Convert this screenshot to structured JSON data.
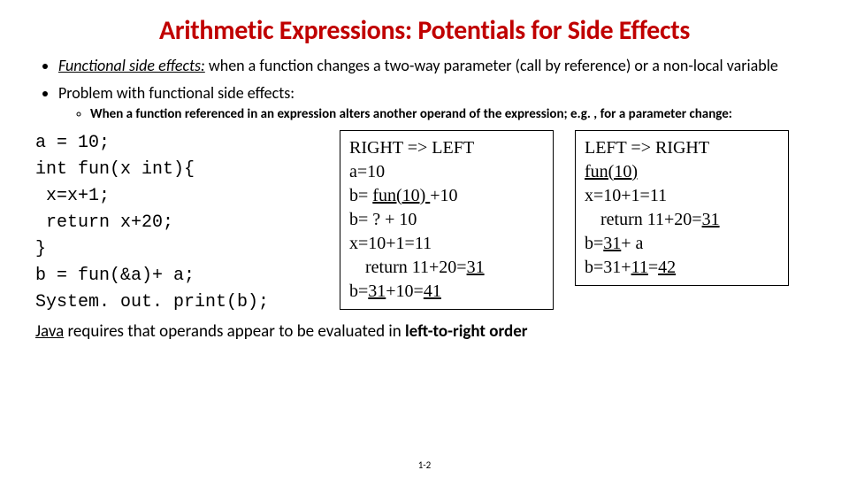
{
  "title": "Arithmetic Expressions: Potentials for Side Effects",
  "bullets": {
    "b1_lead": "Functional side effects:",
    "b1_rest": " when a function changes a two-way parameter (call by reference) or a non-local variable",
    "b2": "Problem with functional side effects:",
    "b2_sub": "When a function referenced in an expression alters another operand of the expression; e.g. , for a parameter change:"
  },
  "code": {
    "l1": "a = 10;",
    "l2": "int fun(x int){",
    "l3": " x=x+1;",
    "l4": " return x+20;",
    "l5": "}",
    "l6": "b = fun(&a)+ a;",
    "l7": "System. out. print(b);"
  },
  "boxA": {
    "h": "RIGHT => LEFT",
    "r1": "a=10",
    "r2a": "b= ",
    "r2b": "fun(10) ",
    "r2c": "+10",
    "r3": "b= ? + 10",
    "r4": "x=10+1=11",
    "r5a": "return 11+20=",
    "r5b": "31",
    "r6a": "b=",
    "r6b": "31",
    "r6c": "+10=",
    "r6d": "41"
  },
  "boxB": {
    "h": "LEFT => RIGHT",
    "r1": "fun(10)",
    "r2": "x=10+1=11",
    "r3a": "return 11+20=",
    "r3b": "31",
    "r4a": "b=",
    "r4b": "31",
    "r4c": "+ a",
    "r5a": "b=31+",
    "r5b": "11",
    "r5c": "=",
    "r5d": "42"
  },
  "footer": {
    "lead": "Java",
    "rest": " requires that operands appear to be evaluated in ",
    "em": "left-to-right order"
  },
  "pagenum": "1-2"
}
